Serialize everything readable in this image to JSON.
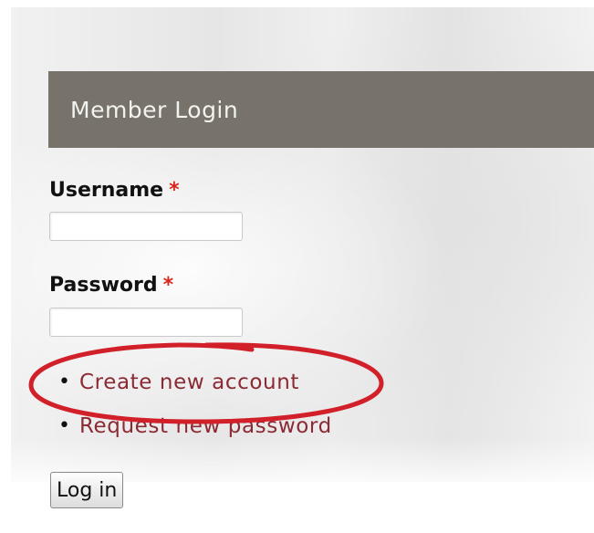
{
  "login_block": {
    "title": "Member Login"
  },
  "form": {
    "username": {
      "label": "Username",
      "required_marker": "*",
      "value": ""
    },
    "password": {
      "label": "Password",
      "required_marker": "*",
      "value": ""
    },
    "links": [
      {
        "bullet": "•",
        "label": "Create new account"
      },
      {
        "bullet": "•",
        "label": "Request new password"
      }
    ],
    "submit_label": "Log in"
  },
  "annotation": {
    "highlighted_item": "Create new account",
    "color": "#d2202a"
  },
  "colors": {
    "header_bg": "#77736b",
    "header_text": "#f2f2ee",
    "link": "#8b2a34",
    "required": "#d9261c"
  }
}
